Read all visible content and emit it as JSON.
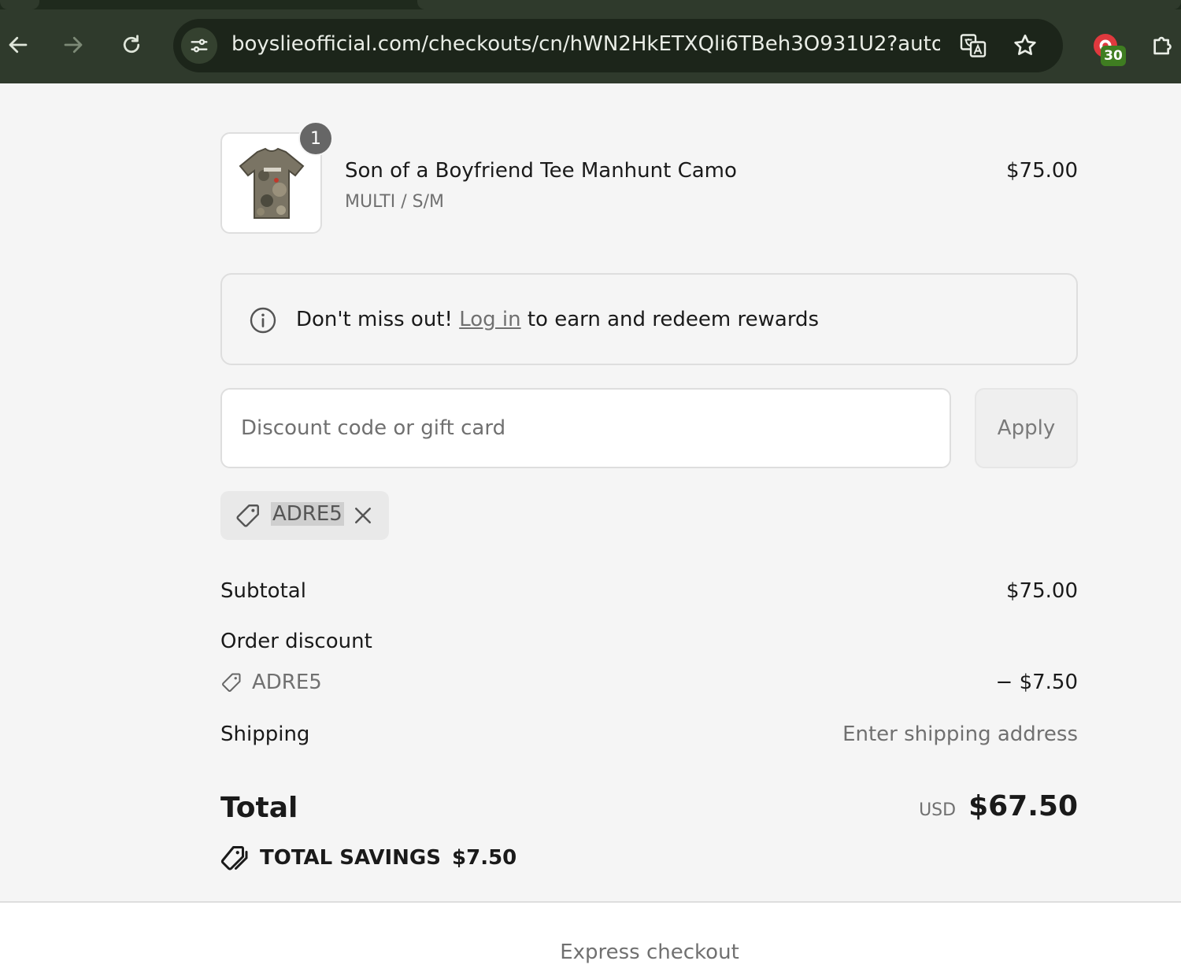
{
  "browser": {
    "url": "boyslieofficial.com/checkouts/cn/hWN2HkETXQli6TBeh3O931U2?auto...",
    "extension_badge": "30",
    "icons": [
      "back-arrow-icon",
      "forward-arrow-icon",
      "reload-icon",
      "site-info-icon",
      "translate-icon",
      "bookmark-star-icon",
      "extension-icon",
      "puzzle-extensions-icon"
    ]
  },
  "line_item": {
    "quantity": "1",
    "name": "Son of a Boyfriend Tee Manhunt Camo",
    "variant": "MULTI / S/M",
    "price": "$75.00"
  },
  "rewards": {
    "prefix": "Don't miss out! ",
    "link": "Log in",
    "suffix": " to earn and redeem rewards"
  },
  "discount": {
    "placeholder": "Discount code or gift card",
    "apply_label": "Apply",
    "applied_code": "ADRE5"
  },
  "totals": {
    "subtotal_label": "Subtotal",
    "subtotal_value": "$75.00",
    "order_discount_label": "Order discount",
    "order_discount_code": "ADRE5",
    "order_discount_value": "− $7.50",
    "shipping_label": "Shipping",
    "shipping_value": "Enter shipping address",
    "total_label": "Total",
    "total_currency": "USD",
    "total_value": "$67.50",
    "savings_label": "TOTAL SAVINGS",
    "savings_value": "$7.50"
  },
  "footer": {
    "express_checkout": "Express checkout"
  },
  "colors": {
    "chrome_bg": "#2f3a2c",
    "omnibox_bg": "#1c251a",
    "page_bg": "#f5f5f5",
    "muted_text": "#707070",
    "badge_green": "#3f7d21"
  }
}
